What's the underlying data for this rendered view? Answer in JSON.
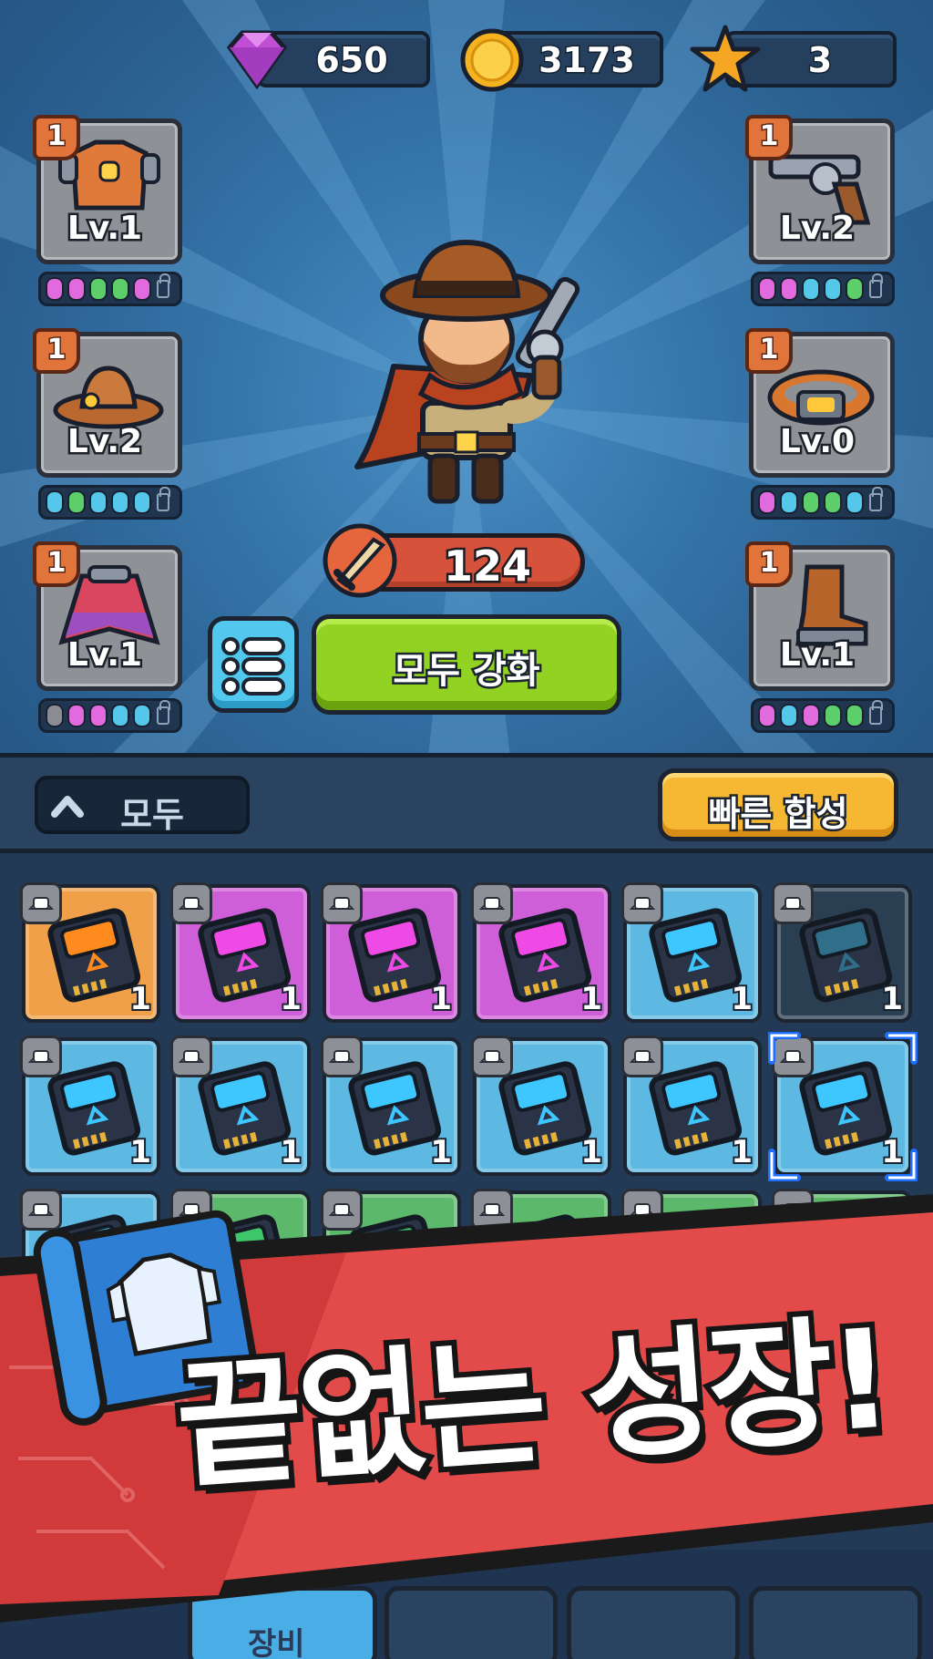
{
  "currencies": {
    "gems": "650",
    "gold": "3173",
    "stars": "3"
  },
  "equipment": [
    {
      "slot": "armor",
      "rank": "1",
      "level": "Lv.1",
      "icon": "armor-icon",
      "pips": [
        "#e26adf",
        "#e26adf",
        "#5ccf6a",
        "#5ccf6a",
        "#e26adf"
      ]
    },
    {
      "slot": "hat",
      "rank": "1",
      "level": "Lv.2",
      "icon": "cowboy-hat-icon",
      "pips": [
        "#55c7ea",
        "#5ccf6a",
        "#55c7ea",
        "#55c7ea",
        "#55c7ea"
      ]
    },
    {
      "slot": "cape",
      "rank": "1",
      "level": "Lv.1",
      "icon": "poncho-icon",
      "pips": [
        "#8a8d93",
        "#e26adf",
        "#e26adf",
        "#55c7ea",
        "#55c7ea"
      ]
    },
    {
      "slot": "weapon",
      "rank": "1",
      "level": "Lv.2",
      "icon": "revolver-icon",
      "pips": [
        "#e26adf",
        "#e26adf",
        "#55c7ea",
        "#55c7ea",
        "#5ccf6a"
      ]
    },
    {
      "slot": "belt",
      "rank": "1",
      "level": "Lv.0",
      "icon": "belt-icon",
      "pips": [
        "#e26adf",
        "#55c7ea",
        "#5ccf6a",
        "#5ccf6a",
        "#55c7ea"
      ]
    },
    {
      "slot": "boots",
      "rank": "1",
      "level": "Lv.1",
      "icon": "boots-icon",
      "pips": [
        "#e26adf",
        "#55c7ea",
        "#e26adf",
        "#5ccf6a",
        "#5ccf6a"
      ]
    }
  ],
  "power": "124",
  "buttons": {
    "upgrade_all": "모두 강화",
    "quick_merge": "빠른 합성",
    "filter": "모두"
  },
  "inventory": [
    {
      "category": "hat-icon",
      "rarity": "orange",
      "count": "1"
    },
    {
      "category": "hat-icon",
      "rarity": "purple",
      "count": "1"
    },
    {
      "category": "armor-icon",
      "rarity": "purple",
      "count": "1"
    },
    {
      "category": "gun-icon",
      "rarity": "purple",
      "count": "1"
    },
    {
      "category": "shirt-icon",
      "rarity": "blue",
      "count": "1"
    },
    {
      "category": "shirt-icon",
      "rarity": "dark",
      "count": "1"
    },
    {
      "category": "hat-icon",
      "rarity": "blue",
      "count": "1"
    },
    {
      "category": "hat-icon",
      "rarity": "blue",
      "count": "1"
    },
    {
      "category": "armor-icon",
      "rarity": "blue",
      "count": "1"
    },
    {
      "category": "gun-icon",
      "rarity": "blue",
      "count": "1"
    },
    {
      "category": "gun-icon",
      "rarity": "blue",
      "count": "1"
    },
    {
      "category": "gun-icon",
      "rarity": "blue",
      "count": "1",
      "selected": true
    },
    {
      "category": "boots-icon",
      "rarity": "blue",
      "count": ""
    },
    {
      "category": "hat-icon",
      "rarity": "green",
      "count": ""
    },
    {
      "category": "hat-icon",
      "rarity": "green",
      "count": ""
    },
    {
      "category": "hat-icon",
      "rarity": "green",
      "count": ""
    },
    {
      "category": "hat-icon",
      "rarity": "green",
      "count": ""
    },
    {
      "category": "armor-icon",
      "rarity": "green",
      "count": ""
    }
  ],
  "banner": {
    "text": "끝없는 성장!"
  },
  "nav": {
    "active_label": "장비"
  },
  "colors": {
    "orange": "#f0a048",
    "purple": "#cf5fd8",
    "blue": "#5db8e2",
    "dark": "#2a3f52",
    "green": "#5cb86a",
    "banner_red": "#e34a4a"
  }
}
